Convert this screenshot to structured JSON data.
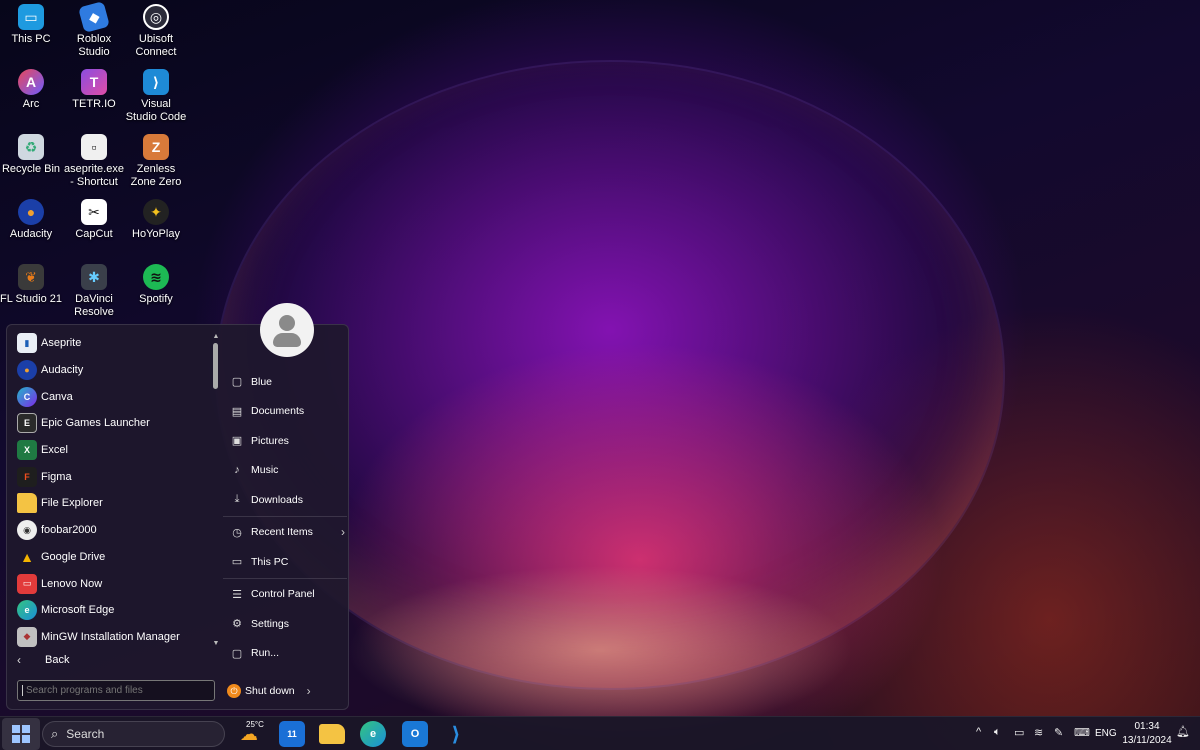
{
  "desktop_icons": [
    {
      "label": "This PC",
      "icon": "monitor-icon",
      "color": "#1e9ae0"
    },
    {
      "label": "Roblox Studio",
      "icon": "roblox-studio-icon",
      "color": "#2f7be0"
    },
    {
      "label": "Ubisoft Connect",
      "icon": "ubisoft-icon",
      "color": "#2b2b3a"
    },
    {
      "label": "Arc",
      "icon": "arc-icon",
      "color": "#e8475a"
    },
    {
      "label": "TETR.IO",
      "icon": "tetrio-icon",
      "color": "#8a4de0"
    },
    {
      "label": "Visual Studio Code",
      "icon": "vscode-icon",
      "color": "#1e8ad6"
    },
    {
      "label": "Recycle Bin",
      "icon": "recycle-bin-icon",
      "color": "#cfd8e0"
    },
    {
      "label": "aseprite.exe - Shortcut",
      "icon": "aseprite-icon",
      "color": "#f0f0f0"
    },
    {
      "label": "Zenless Zone Zero",
      "icon": "zzz-icon",
      "color": "#d87a3a"
    },
    {
      "label": "Audacity",
      "icon": "audacity-icon",
      "color": "#1b3fa8"
    },
    {
      "label": "CapCut",
      "icon": "capcut-icon",
      "color": "#111111"
    },
    {
      "label": "HoYoPlay",
      "icon": "hoyoplay-icon",
      "color": "#f2c01e"
    },
    {
      "label": "FL Studio 21",
      "icon": "fl-studio-icon",
      "color": "#e77b1a"
    },
    {
      "label": "DaVinci Resolve",
      "icon": "davinci-icon",
      "color": "#3a3f4a"
    },
    {
      "label": "Spotify",
      "icon": "spotify-icon",
      "color": "#1db954"
    }
  ],
  "start_menu": {
    "programs": [
      {
        "label": "Aseprite",
        "icon": "aseprite-icon",
        "color": "#e9eef5",
        "glyph": "▮"
      },
      {
        "label": "Audacity",
        "icon": "audacity-icon",
        "color": "#1b3fa8",
        "glyph": "●"
      },
      {
        "label": "Canva",
        "icon": "canva-icon",
        "color": "#24b5c9",
        "glyph": "C"
      },
      {
        "label": "Epic Games Launcher",
        "icon": "epic-games-icon",
        "color": "#2a2a2a",
        "glyph": "E"
      },
      {
        "label": "Excel",
        "icon": "excel-icon",
        "color": "#1f7a43",
        "glyph": "X"
      },
      {
        "label": "Figma",
        "icon": "figma-icon",
        "color": "#1e1e1e",
        "glyph": "F"
      },
      {
        "label": "File Explorer",
        "icon": "folder-icon",
        "color": "#f4c343",
        "glyph": ""
      },
      {
        "label": "foobar2000",
        "icon": "foobar-icon",
        "color": "#eeeeee",
        "glyph": "◉"
      },
      {
        "label": "Google Drive",
        "icon": "google-drive-icon",
        "color": "#2a2a2a",
        "glyph": "▲"
      },
      {
        "label": "Lenovo Now",
        "icon": "lenovo-now-icon",
        "color": "#e23b3b",
        "glyph": "▭"
      },
      {
        "label": "Microsoft Edge",
        "icon": "edge-icon",
        "color": "#1b8ed8",
        "glyph": "e"
      },
      {
        "label": "MinGW Installation Manager",
        "icon": "mingw-icon",
        "color": "#c0c0c0",
        "glyph": "◆"
      }
    ],
    "back_label": "Back",
    "search_placeholder": "Search programs and files",
    "places": [
      {
        "label": "Blue",
        "icon": "user-folder-icon",
        "glyph": "▢"
      },
      {
        "label": "Documents",
        "icon": "document-icon",
        "glyph": "▤"
      },
      {
        "label": "Pictures",
        "icon": "picture-icon",
        "glyph": "▣"
      },
      {
        "label": "Music",
        "icon": "music-icon",
        "glyph": "♪"
      },
      {
        "label": "Downloads",
        "icon": "download-icon",
        "glyph": "⤓"
      },
      {
        "label": "Recent Items",
        "icon": "clock-icon",
        "glyph": "◷",
        "has_submenu": true
      },
      {
        "label": "This PC",
        "icon": "computer-icon",
        "glyph": "▭"
      },
      {
        "label": "Control Panel",
        "icon": "control-panel-icon",
        "glyph": "☰"
      },
      {
        "label": "Settings",
        "icon": "gear-icon",
        "glyph": "⚙"
      },
      {
        "label": "Run...",
        "icon": "run-icon",
        "glyph": "▢"
      }
    ],
    "shutdown_label": "Shut down"
  },
  "taskbar": {
    "search_label": "Search",
    "weather_temp": "25°C",
    "apps": [
      {
        "name": "weather-icon"
      },
      {
        "name": "terminal-badge-icon",
        "badge": "11"
      },
      {
        "name": "file-explorer-icon"
      },
      {
        "name": "edge-icon"
      },
      {
        "name": "outlook-icon"
      },
      {
        "name": "vscode-icon"
      }
    ],
    "language": "ENG",
    "time": "01:34",
    "date": "13/11/2024"
  }
}
